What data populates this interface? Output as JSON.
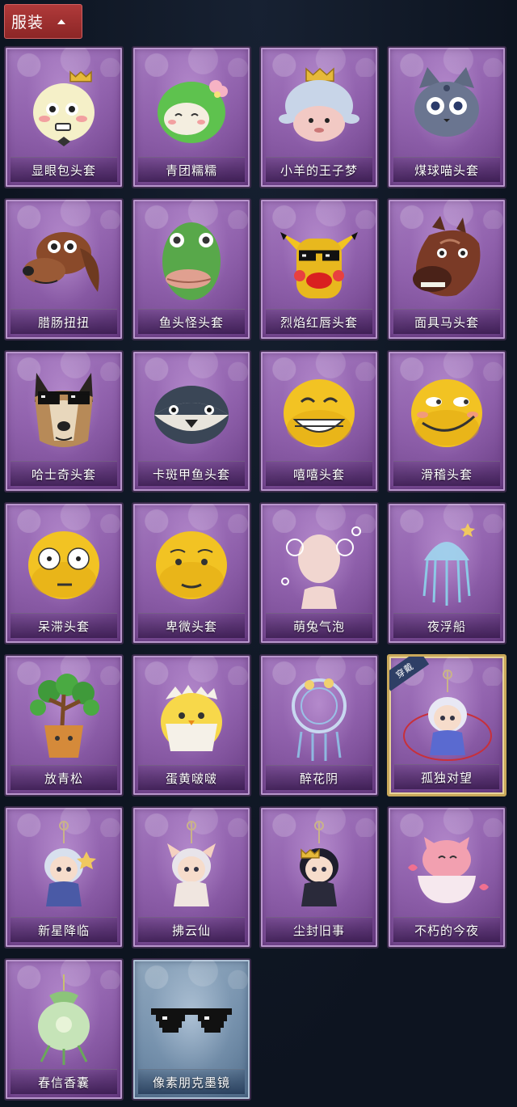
{
  "header": {
    "title": "服装",
    "toggle_icon": "chevron-up-icon"
  },
  "items": [
    {
      "label": "显眼包头套",
      "icon": "round-face-crown-icon",
      "theme": "purple"
    },
    {
      "label": "青团糯糯",
      "icon": "green-blob-flower-icon",
      "theme": "purple"
    },
    {
      "label": "小羊的王子梦",
      "icon": "sheep-crown-icon",
      "theme": "purple"
    },
    {
      "label": "煤球喵头套",
      "icon": "gray-cat-head-icon",
      "theme": "purple"
    },
    {
      "label": "腊肠扭扭",
      "icon": "dachshund-head-icon",
      "theme": "purple"
    },
    {
      "label": "鱼头怪头套",
      "icon": "fish-head-icon",
      "theme": "purple"
    },
    {
      "label": "烈焰红唇头套",
      "icon": "yellow-mouse-sunglasses-icon",
      "theme": "purple"
    },
    {
      "label": "面具马头套",
      "icon": "horse-head-icon",
      "theme": "purple"
    },
    {
      "label": "哈士奇头套",
      "icon": "husky-sunglasses-icon",
      "theme": "purple"
    },
    {
      "label": "卡斑甲鱼头套",
      "icon": "puffer-fish-icon",
      "theme": "purple"
    },
    {
      "label": "嘻嘻头套",
      "icon": "grin-emoji-icon",
      "theme": "purple"
    },
    {
      "label": "滑稽头套",
      "icon": "smirk-emoji-icon",
      "theme": "purple"
    },
    {
      "label": "呆滞头套",
      "icon": "stare-emoji-icon",
      "theme": "purple"
    },
    {
      "label": "卑微头套",
      "icon": "sad-emoji-icon",
      "theme": "purple"
    },
    {
      "label": "萌兔气泡",
      "icon": "bunny-bubble-icon",
      "theme": "purple"
    },
    {
      "label": "夜浮船",
      "icon": "jellyfish-icon",
      "theme": "purple"
    },
    {
      "label": "放青松",
      "icon": "bonsai-pine-icon",
      "theme": "purple"
    },
    {
      "label": "蛋黄啵啵",
      "icon": "chick-eggshell-icon",
      "theme": "purple"
    },
    {
      "label": "醉花阴",
      "icon": "dreamcatcher-icon",
      "theme": "purple"
    },
    {
      "label": "孤独对望",
      "icon": "doll-charm-icon",
      "theme": "purple",
      "worn": true,
      "badge": "穿戴"
    },
    {
      "label": "新星降临",
      "icon": "star-doll-charm-icon",
      "theme": "purple"
    },
    {
      "label": "拂云仙",
      "icon": "fox-doll-charm-icon",
      "theme": "purple"
    },
    {
      "label": "尘封旧事",
      "icon": "crown-doll-charm-icon",
      "theme": "purple"
    },
    {
      "label": "不朽的今夜",
      "icon": "pink-cat-bowl-icon",
      "theme": "purple"
    },
    {
      "label": "春信香囊",
      "icon": "sachet-icon",
      "theme": "purple"
    },
    {
      "label": "像素朋克墨镜",
      "icon": "pixel-sunglasses-icon",
      "theme": "blue"
    }
  ],
  "colors": {
    "background": "#0f1622",
    "header": "#9c2e2e",
    "card": "#8c5ea8",
    "card_blue": "#6e8aa6",
    "worn_border": "#c9a85a",
    "badge": "#2e3f66"
  }
}
